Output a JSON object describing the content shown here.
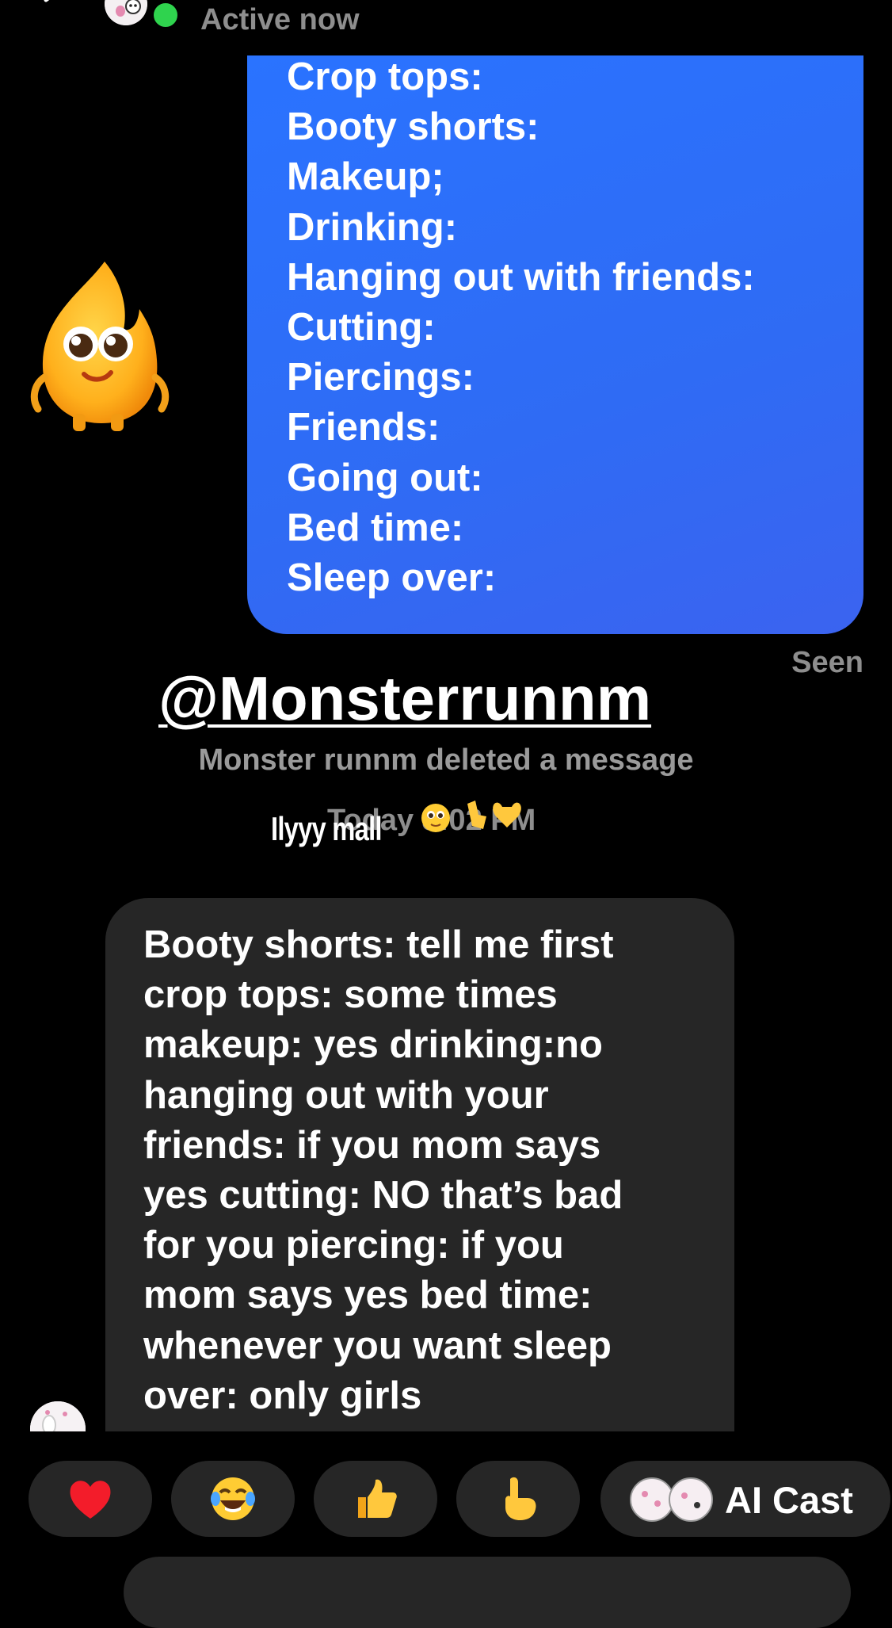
{
  "header": {
    "status": "Active now"
  },
  "outgoing_message": {
    "lines": [
      "Crop tops:",
      "Booty shorts:",
      "Makeup;",
      "Drinking:",
      "Hanging out with friends:",
      "Cutting:",
      "Piercings:",
      "Friends:",
      "Going out:",
      "Bed time:",
      "Sleep over:"
    ],
    "receipt": "Seen"
  },
  "overlays": {
    "username": "@Monsterrunnm",
    "handwritten_text": "Ilyyy mall"
  },
  "system": {
    "deleted_notice": "Monster runnm deleted a message",
    "timestamp": "Today 3:02 PM"
  },
  "incoming_message": {
    "lines": [
      "Booty shorts: tell me first",
      "crop tops: some times",
      "makeup: yes drinking:no",
      "hanging out with your",
      "friends: if you mom says",
      "yes cutting: NO that’s bad",
      "for you piercing: if you",
      "mom says yes bed time:",
      "whenever you want sleep",
      "over: only girls"
    ]
  },
  "quick_reactions": {
    "items": [
      "❤️",
      "😂",
      "👍",
      "👆"
    ],
    "ai_cast_label": "AI Cast"
  },
  "colors": {
    "outgoing_bubble": "#2f6bf4",
    "incoming_bubble": "#262626",
    "online": "#2fd34e",
    "muted_text": "#8e8e8e"
  }
}
